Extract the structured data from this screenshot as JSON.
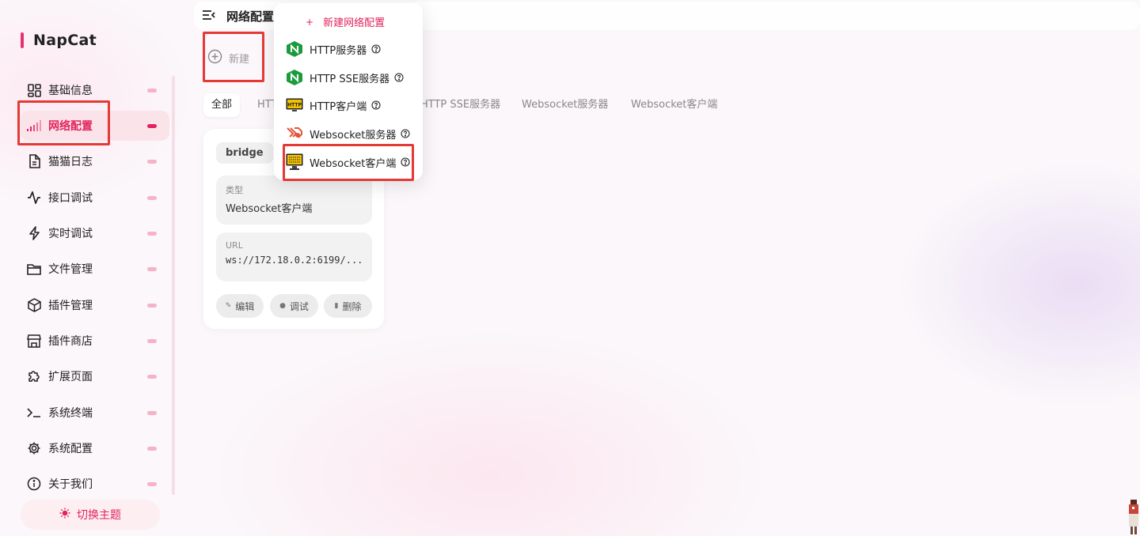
{
  "app": {
    "name": "NapCat"
  },
  "colors": {
    "accent": "#e2245d",
    "highlight_box": "#e53935"
  },
  "sidebar": {
    "items": [
      {
        "label": "基础信息",
        "icon": "dashboard-icon",
        "active": false
      },
      {
        "label": "网络配置",
        "icon": "signal-bars-icon",
        "active": true
      },
      {
        "label": "猫猫日志",
        "icon": "document-icon",
        "active": false
      },
      {
        "label": "接口调试",
        "icon": "activity-icon",
        "active": false
      },
      {
        "label": "实时调试",
        "icon": "lightning-icon",
        "active": false
      },
      {
        "label": "文件管理",
        "icon": "folder-icon",
        "active": false
      },
      {
        "label": "插件管理",
        "icon": "package-icon",
        "active": false
      },
      {
        "label": "插件商店",
        "icon": "store-icon",
        "active": false
      },
      {
        "label": "扩展页面",
        "icon": "puzzle-icon",
        "active": false
      },
      {
        "label": "系统终端",
        "icon": "terminal-icon",
        "active": false
      },
      {
        "label": "系统配置",
        "icon": "gear-icon",
        "active": false
      },
      {
        "label": "关于我们",
        "icon": "info-icon",
        "active": false
      }
    ],
    "theme_toggle": {
      "label": "切换主题",
      "icon": "sun-icon"
    }
  },
  "header": {
    "title": "网络配置",
    "menu_icon": "menu-collapse-icon"
  },
  "toolbar": {
    "new_label": "新建",
    "new_icon": "plus-circle-icon"
  },
  "tabs": [
    {
      "label": "全部",
      "active": true
    },
    {
      "label": "HTTP服务器",
      "active": false
    },
    {
      "label": "HTTP SSE服务器",
      "active": false
    },
    {
      "label": "Websocket服务器",
      "active": false
    },
    {
      "label": "Websocket客户端",
      "active": false
    }
  ],
  "card": {
    "name": "bridge",
    "type_key": "类型",
    "type_value": "Websocket客户端",
    "url_key": "URL",
    "url_value": "ws://172.18.0.2:6199/...",
    "actions": [
      {
        "label": "编辑",
        "icon": "edit-icon"
      },
      {
        "label": "调试",
        "icon": "debug-icon"
      },
      {
        "label": "删除",
        "icon": "trash-icon"
      }
    ]
  },
  "dropdown": {
    "header": "新建网络配置",
    "items": [
      {
        "label": "HTTP服务器",
        "icon": "nginx-icon"
      },
      {
        "label": "HTTP SSE服务器",
        "icon": "nginx-icon"
      },
      {
        "label": "HTTP客户端",
        "icon": "http-monitor-icon"
      },
      {
        "label": "Websocket服务器",
        "icon": "websocket-server-icon"
      },
      {
        "label": "Websocket客户端",
        "icon": "websocket-client-icon"
      }
    ]
  }
}
